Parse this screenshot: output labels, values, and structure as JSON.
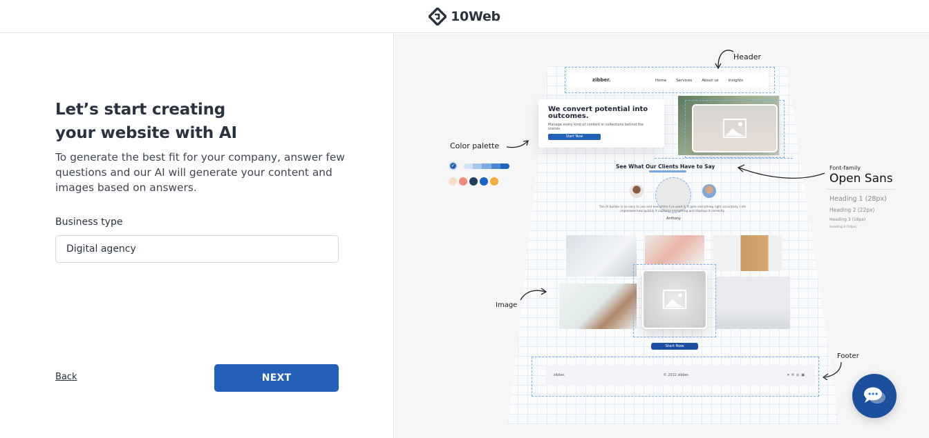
{
  "header": {
    "brand": "10Web"
  },
  "form": {
    "title_line1": "Let’s start creating",
    "title_line2": "your website with AI",
    "description": "To generate the best fit for your company, answer few questions and our AI will generate your content and images based on answers.",
    "business_type_label": "Business type",
    "business_type_value": "Digital agency",
    "back_label": "Back",
    "next_label": "NEXT"
  },
  "colors": {
    "accent": "#2361b8",
    "text": "#2a3240"
  },
  "preview": {
    "annotations": {
      "header": "Header",
      "color_palette": "Color palette",
      "image": "Image",
      "footer": "Footer",
      "font_family": "Font-family"
    },
    "mock_site": {
      "brand": "zibber.",
      "nav": [
        "Home",
        "Services",
        "About us",
        "Insights"
      ],
      "hero_title": "We convert potential into outcomes.",
      "hero_subtitle": "Manage every kind of content in collections behind the scenes",
      "hero_button": "Start Now",
      "clients_title": "See What Our Clients Have to Say",
      "testimonial": "The AI builder is so easy to use and everytime I've used it, it gets everything right accurately. I am impressed how quickly it captures everything and displays it correctly.",
      "testimonial_author": "Anthony",
      "gallery_button": "Start Now",
      "footer_brand": "zibber.",
      "footer_copyright": "© 2022 zibber."
    },
    "palette": {
      "blues": [
        "#d3e2f5",
        "#a9c7ec",
        "#7eabe1",
        "#4f88d0",
        "#1f64be"
      ],
      "swatches": [
        "#f8dfc6",
        "#f28a79",
        "#243a5e",
        "#1565c0",
        "#f4ad3d"
      ]
    },
    "typography": {
      "font_name": "Open Sans",
      "headings": [
        "Heading 1 (28px)",
        "Heading 2 (22px)",
        "Heading 3 (18px)",
        "Heading 4 (14px)"
      ]
    }
  }
}
